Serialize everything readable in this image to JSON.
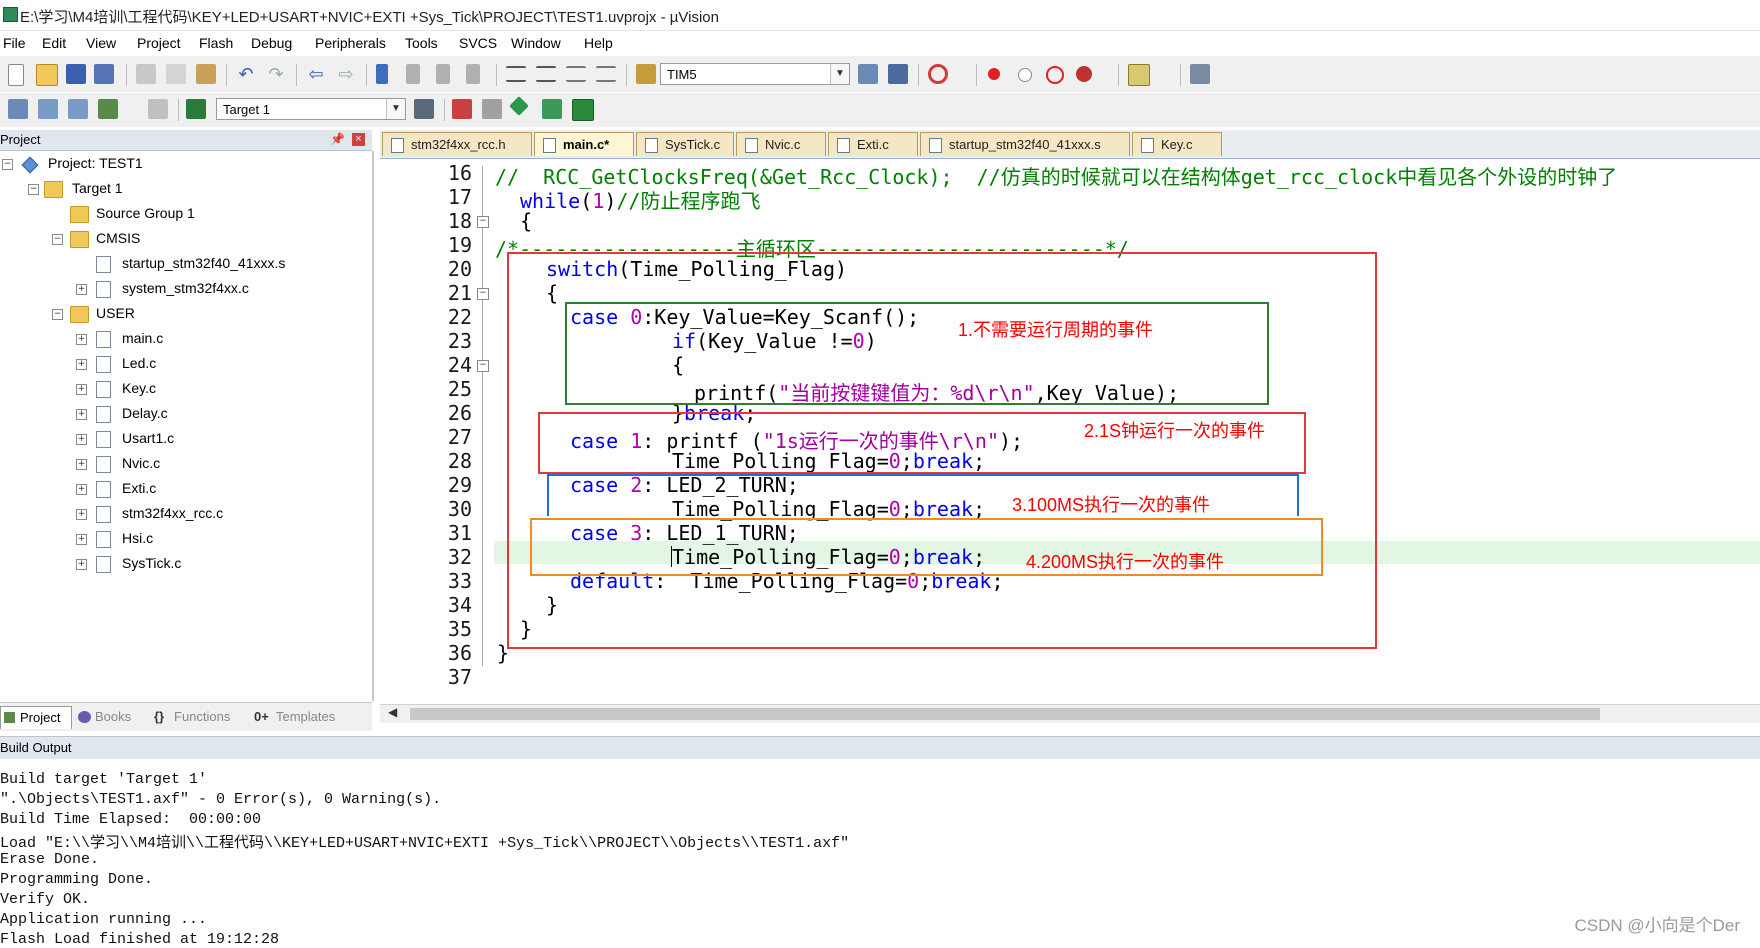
{
  "window": {
    "title": "E:\\学习\\M4培训\\工程代码\\KEY+LED+USART+NVIC+EXTI +Sys_Tick\\PROJECT\\TEST1.uvprojx - µVision"
  },
  "menu": [
    "File",
    "Edit",
    "View",
    "Project",
    "Flash",
    "Debug",
    "Peripherals",
    "Tools",
    "SVCS",
    "Window",
    "Help"
  ],
  "toolbar": {
    "find_combo": "TIM5",
    "target_combo": "Target 1",
    "icons": [
      "new-file-icon",
      "open-folder-icon",
      "save-icon",
      "save-all-icon",
      "cut-icon",
      "copy-icon",
      "paste-icon",
      "undo-icon",
      "redo-icon",
      "nav-back-icon",
      "nav-forward-icon",
      "bookmark-icon",
      "indent-icon",
      "unindent-icon",
      "comment-icon",
      "uncomment-icon",
      "find-in-files-icon",
      "debug-icon",
      "breakpoint-icon",
      "settings-icon",
      "build-icon",
      "rebuild-icon",
      "download-icon"
    ]
  },
  "project_panel": {
    "header": "Project",
    "tree": [
      {
        "label": "Project: TEST1",
        "type": "project",
        "expanded": true
      },
      {
        "label": "Target 1",
        "type": "folder",
        "expanded": true
      },
      {
        "label": "Source Group 1",
        "type": "folder",
        "expanded": false
      },
      {
        "label": "CMSIS",
        "type": "folder",
        "expanded": true
      },
      {
        "label": "startup_stm32f40_41xxx.s",
        "type": "file"
      },
      {
        "label": "system_stm32f4xx.c",
        "type": "file"
      },
      {
        "label": "USER",
        "type": "folder",
        "expanded": true
      },
      {
        "label": "main.c",
        "type": "file"
      },
      {
        "label": "Led.c",
        "type": "file"
      },
      {
        "label": "Key.c",
        "type": "file"
      },
      {
        "label": "Delay.c",
        "type": "file"
      },
      {
        "label": "Usart1.c",
        "type": "file"
      },
      {
        "label": "Nvic.c",
        "type": "file"
      },
      {
        "label": "Exti.c",
        "type": "file"
      },
      {
        "label": "stm32f4xx_rcc.c",
        "type": "file"
      },
      {
        "label": "Hsi.c",
        "type": "file"
      },
      {
        "label": "SysTick.c",
        "type": "file"
      }
    ],
    "tabs": [
      "Project",
      "Books",
      "Functions",
      "Templates"
    ]
  },
  "editor": {
    "tabs": [
      "stm32f4xx_rcc.h",
      "main.c*",
      "SysTick.c",
      "Nvic.c",
      "Exti.c",
      "startup_stm32f40_41xxx.s",
      "Key.c"
    ],
    "active_tab": "main.c*",
    "line_numbers": [
      "16",
      "17",
      "18",
      "19",
      "20",
      "21",
      "22",
      "23",
      "24",
      "25",
      "26",
      "27",
      "28",
      "29",
      "30",
      "31",
      "32",
      "33",
      "34",
      "35",
      "36",
      "37"
    ],
    "lines": {
      "l16": "//  RCC_GetClocksFreq(&Get_Rcc_Clock);  //仿真的时候就可以在结构体get_rcc_clock中看见各个外设的时钟了",
      "l17a": "while",
      "l17b": "(",
      "l17c": "1",
      "l17d": ")",
      "l17e": "//防止程序跑飞",
      "l18": "{",
      "l19": "/*------------------主循环区------------------------*/",
      "l20a": "switch",
      "l20b": "(Time_Polling_Flag)",
      "l21": "{",
      "l22a": "case",
      "l22b": " ",
      "l22c": "0",
      "l22d": ":Key_Value=Key_Scanf();",
      "l23a": "if",
      "l23b": "(Key_Value !=",
      "l23c": "0",
      "l23d": ")",
      "l24": "{",
      "l25a": "printf(",
      "l25b": "\"当前按键键值为：%d\\r\\n\"",
      "l25c": ",Key_Value);",
      "l26a": "}",
      "l26b": "break",
      "l26c": ";",
      "l27a": "case",
      "l27b": "1",
      "l27c": ": printf (",
      "l27d": "\"1s运行一次的事件\\r\\n\"",
      "l27e": ");",
      "l28a": "Time_Polling_Flag=",
      "l28b": "0",
      "l28c": ";",
      "l28d": "break",
      "l28e": ";",
      "l29a": "case",
      "l29b": "2",
      "l29c": ": LED_2_TURN;",
      "l30a": "Time_Polling_Flag=",
      "l30b": "0",
      "l30c": ";",
      "l30d": "break",
      "l30e": ";",
      "l31a": "case",
      "l31b": "3",
      "l31c": ": LED_1_TURN;",
      "l32a": "Time_Polling_Flag=",
      "l32b": "0",
      "l32c": ";",
      "l32d": "break",
      "l32e": ";",
      "l33a": "default",
      "l33b": ":  Time_Polling_Flag=",
      "l33c": "0",
      "l33d": ";",
      "l33e": "break",
      "l33f": ";",
      "l34": "}",
      "l35": "}",
      "l36": "}"
    },
    "annotations": [
      {
        "text": "1.不需要运行周期的事件",
        "color": "#ff0000",
        "box_color": "#2e7d32"
      },
      {
        "text": "2.1S钟运行一次的事件",
        "color": "#ff0000",
        "box_color": "#e53935"
      },
      {
        "text": "3.100MS执行一次的事件",
        "color": "#ff0000",
        "box_color": "#1e6fd9"
      },
      {
        "text": "4.200MS执行一次的事件",
        "color": "#ff0000",
        "box_color": "#f0892a"
      }
    ],
    "outer_box_color": "#e53935"
  },
  "build_output": {
    "header": "Build Output",
    "lines": [
      "Build target 'Target 1'",
      "\".\\Objects\\TEST1.axf\" - 0 Error(s), 0 Warning(s).",
      "Build Time Elapsed:  00:00:00",
      "Load \"E:\\\\学习\\\\M4培训\\\\工程代码\\\\KEY+LED+USART+NVIC+EXTI +Sys_Tick\\\\PROJECT\\\\Objects\\\\TEST1.axf\"",
      "Erase Done.",
      "Programming Done.",
      "Verify OK.",
      "Application running ...",
      "Flash Load finished at 19:12:28"
    ]
  },
  "watermark": "CSDN @小向是个Der"
}
